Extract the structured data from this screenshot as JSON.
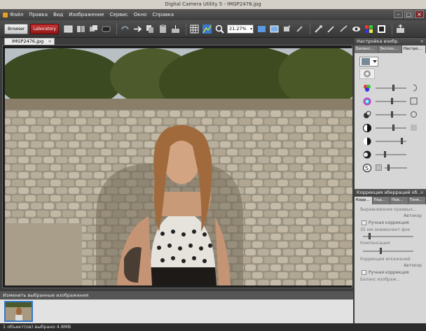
{
  "window": {
    "title": "Digital Camera Utility 5 - IMGP2476.jpg"
  },
  "menu": [
    "Файл",
    "Правка",
    "Вид",
    "Изображение",
    "Сервис",
    "Окно",
    "Справка"
  ],
  "toolbar": {
    "browser_label": "Browser",
    "laboratory_label": "Laboratory",
    "zoom_value": "21.27%"
  },
  "document_tab": {
    "label": "IMGP2476.jpg"
  },
  "filmstrip": {
    "title": "Изменить выбранные изображения"
  },
  "statusbar": {
    "text": "1 объект(ов) выбрано   4.8MB"
  },
  "right_panel": {
    "top": {
      "title": "Настройка изобр.",
      "tabs": [
        "Баланс...",
        "Экспоз...",
        "Настро..."
      ],
      "active_tab": 2
    },
    "bottom": {
      "title": "Коррекция аберраций об...",
      "tabs": [
        "Корр...",
        "Под...",
        "Пов...",
        "Тонк..."
      ],
      "active_tab": 0,
      "chromatic_section": "Выравнивание краевых...",
      "auto_label_1": "Автокор",
      "manual_correction": "Ручная коррекция",
      "equiv_35mm": "35 мм эквивалент фок",
      "compensation": "Компенсация",
      "distortion_section": "Коррекция искажений",
      "auto_label_2": "Автокор",
      "manual_correction_2": "Ручная коррекция",
      "cutoff": "Баланс изображ..."
    }
  },
  "colors": {
    "accent_red": "#b02020",
    "chrome_dark": "#3c3c3c",
    "panel_gray": "#d6d6d6"
  }
}
